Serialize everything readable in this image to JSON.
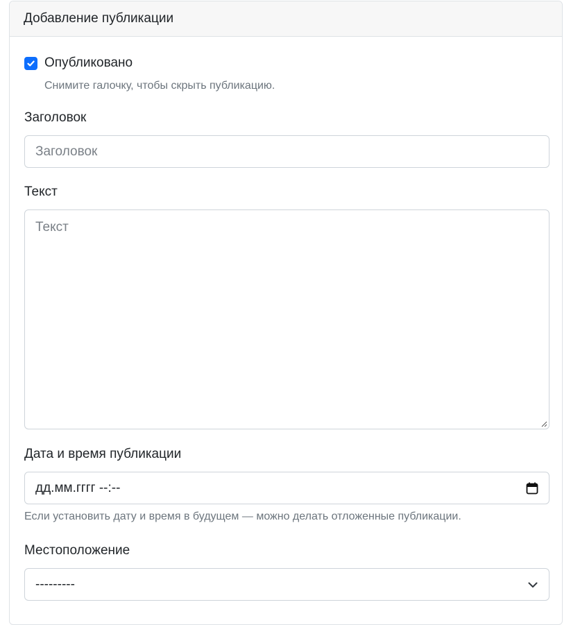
{
  "form": {
    "header": "Добавление публикации",
    "published": {
      "label": "Опубликовано",
      "checked": true,
      "help": "Снимите галочку, чтобы скрыть публикацию."
    },
    "title_field": {
      "label": "Заголовок",
      "value": "",
      "placeholder": "Заголовок"
    },
    "text_field": {
      "label": "Текст",
      "value": "",
      "placeholder": "Текст"
    },
    "pub_date": {
      "label": "Дата и время публикации",
      "value": "дд.мм.гггг --:--",
      "icon": "calendar-icon",
      "help": "Если установить дату и время в будущем — можно делать отложенные публикации."
    },
    "location": {
      "label": "Местоположение",
      "selected": "---------",
      "icon": "chevron-down-icon"
    }
  },
  "colors": {
    "accent": "#0d6efd",
    "border": "#ced4da",
    "muted_text": "#6c757d",
    "header_bg": "#f7f7f7"
  }
}
